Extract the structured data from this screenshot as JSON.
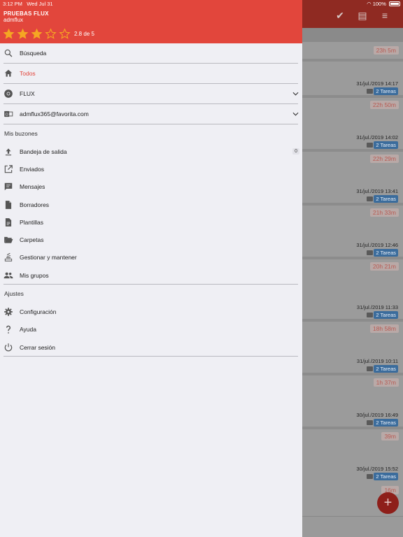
{
  "status_bar": {
    "time": "3:12 PM",
    "date": "Wed Jul 31",
    "battery": "100%"
  },
  "header": {
    "title": "PRUEBAS FLUX",
    "user": "admflux",
    "rating_value": 2.8,
    "rating_text": "2.8 de 5",
    "stars_filled": 3,
    "stars_total": 5,
    "color": "#e2463c"
  },
  "menu": {
    "search": "Búsqueda",
    "todos": "Todos",
    "flux": "FLUX",
    "account": "admflux365@favorita.com",
    "mailboxes_title": "Mis buzones",
    "mailboxes": [
      {
        "label": "Bandeja de salida",
        "icon": "upload-icon",
        "count": "0"
      },
      {
        "label": "Enviados",
        "icon": "open-external-icon"
      },
      {
        "label": "Mensajes",
        "icon": "message-icon"
      },
      {
        "label": "Borradores",
        "icon": "document-icon"
      },
      {
        "label": "Plantillas",
        "icon": "template-icon"
      },
      {
        "label": "Carpetas",
        "icon": "folder-open-icon"
      },
      {
        "label": "Gestionar y mantener",
        "icon": "stack-icon"
      },
      {
        "label": "Mis grupos",
        "icon": "group-icon"
      }
    ],
    "settings_title": "Ajustes",
    "settings": [
      {
        "label": "Configuración",
        "icon": "gear-icon"
      },
      {
        "label": "Ayuda",
        "icon": "question-icon"
      },
      {
        "label": "Cerrar sesión",
        "icon": "power-icon"
      }
    ]
  },
  "background_list": [
    {
      "elapsed": "23h 5m"
    },
    {
      "date": "31/jul./2019 14:17",
      "tasks": "2 Tareas",
      "elapsed": "22h 50m"
    },
    {
      "date": "31/jul./2019 14:02",
      "tasks": "2 Tareas",
      "elapsed": "22h 29m"
    },
    {
      "date": "31/jul./2019 13:41",
      "tasks": "2 Tareas",
      "elapsed": "21h 33m"
    },
    {
      "date": "31/jul./2019 12:46",
      "tasks": "2 Tareas",
      "elapsed": "20h 21m"
    },
    {
      "date": "31/jul./2019 11:33",
      "tasks": "2 Tareas",
      "elapsed": "18h 58m"
    },
    {
      "date": "31/jul./2019 10:11",
      "tasks": "2 Tareas",
      "elapsed": "1h 37m"
    },
    {
      "date": "30/jul./2019 16:49",
      "tasks": "2 Tareas",
      "elapsed": "39m"
    },
    {
      "date": "30/jul./2019 15:52",
      "tasks": "2 Tareas",
      "elapsed": "16m"
    }
  ],
  "fab": {
    "label": "+"
  }
}
